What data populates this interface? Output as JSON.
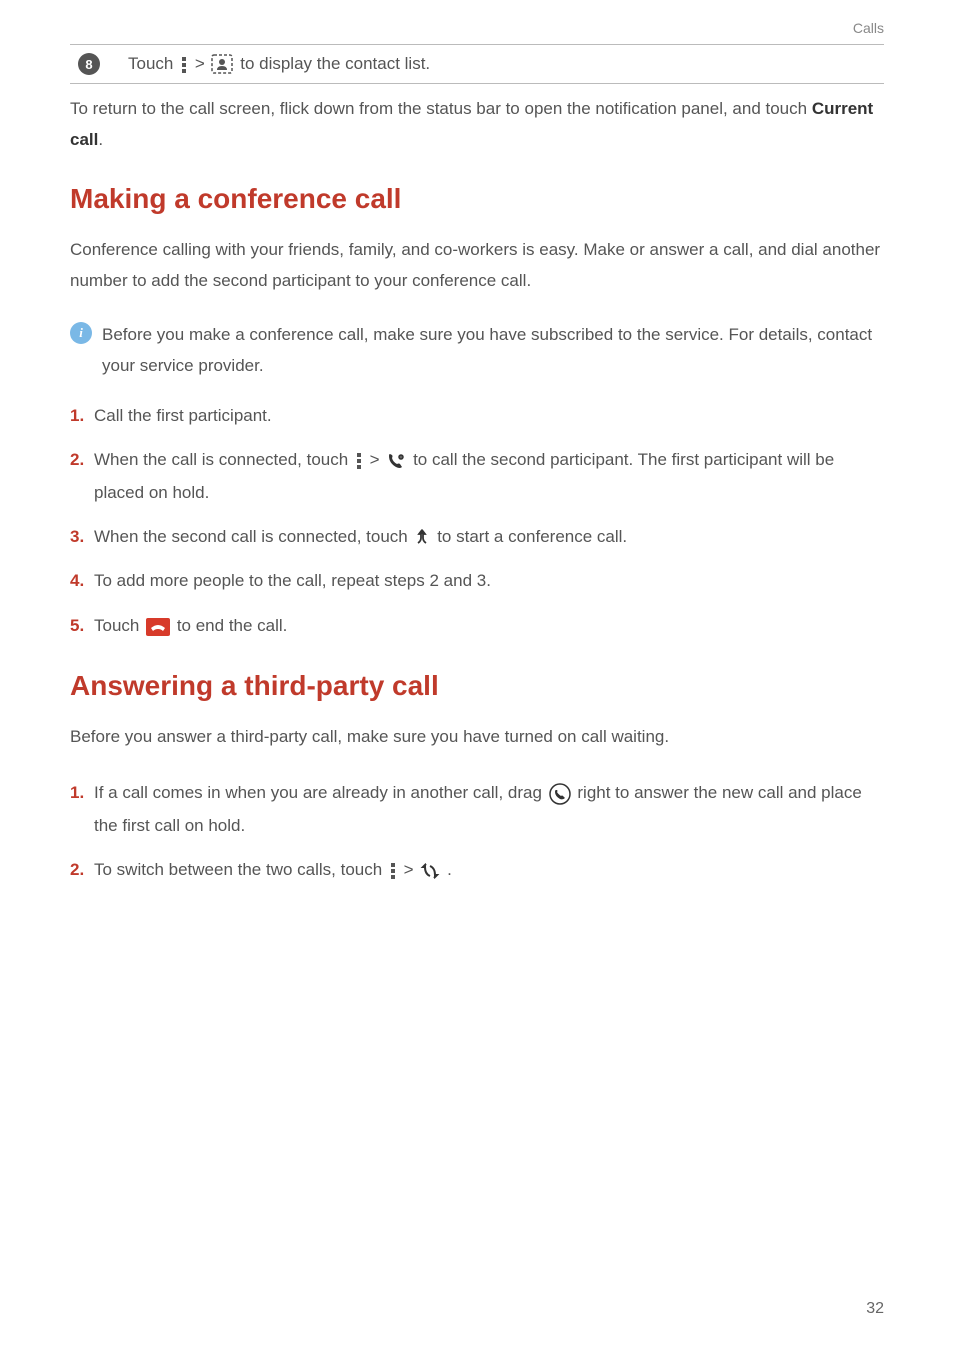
{
  "header": {
    "section_label": "Calls"
  },
  "row8": {
    "num": "8",
    "pre": "Touch ",
    "mid": " > ",
    "post": " to display the contact list."
  },
  "return_text": {
    "pre": "To return to the call screen, flick down from the status bar to open the notification panel, and touch ",
    "bold": "Current call",
    "post": "."
  },
  "conf": {
    "heading": "Making a conference call",
    "intro": "Conference calling with your friends, family, and co-workers is easy. Make or answer a call, and dial another number to add the second participant to your conference call.",
    "info": "Before you make a conference call, make sure you have subscribed to the service. For details, contact your service provider.",
    "steps": [
      {
        "n": "1.",
        "a": "Call the first participant."
      },
      {
        "n": "2.",
        "a": "When the call is connected, touch ",
        "b": " > ",
        "c": " to call the second participant. The first participant will be placed on hold."
      },
      {
        "n": "3.",
        "a": "When the second call is connected, touch ",
        "b": " to start a conference call."
      },
      {
        "n": "4.",
        "a": "To add more people to the call, repeat steps 2 and 3."
      },
      {
        "n": "5.",
        "a": "Touch ",
        "b": " to end the call."
      }
    ]
  },
  "third": {
    "heading": "Answering a third-party call",
    "intro": "Before you answer a third-party call, make sure you have turned on call waiting.",
    "steps": [
      {
        "n": "1.",
        "a": "If a call comes in when you are already in another call, drag ",
        "b": " right to answer the new call and place the first call on hold."
      },
      {
        "n": "2.",
        "a": "To switch between the two calls, touch ",
        "b": " > ",
        "c": " ."
      }
    ]
  },
  "page_number": "32"
}
